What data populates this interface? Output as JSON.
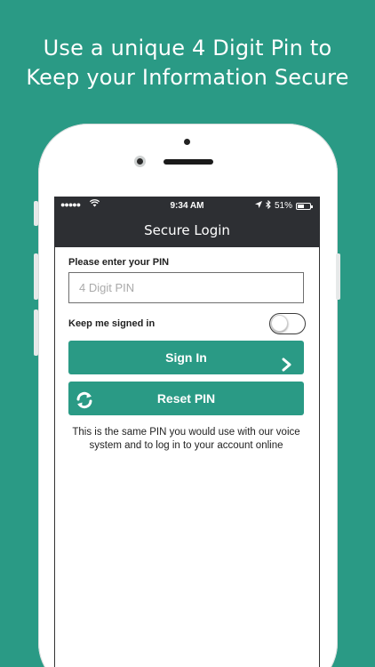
{
  "headline": {
    "line1": "Use a unique 4 Digit Pin to",
    "line2": "Keep your Information Secure"
  },
  "status_bar": {
    "signal": "●●●●●",
    "time": "9:34 AM",
    "battery_percent": "51%"
  },
  "nav": {
    "title": "Secure Login"
  },
  "form": {
    "pin_label": "Please enter your PIN",
    "pin_placeholder": "4 Digit PIN",
    "pin_value": "",
    "keep_signed_in_label": "Keep me signed in",
    "keep_signed_in_on": false
  },
  "buttons": {
    "sign_in": "Sign In",
    "reset_pin": "Reset PIN"
  },
  "note": "This is the same PIN you would use with our voice system and to log in to your account online",
  "colors": {
    "brand": "#2a9a85",
    "navbar": "#2d2f33"
  }
}
